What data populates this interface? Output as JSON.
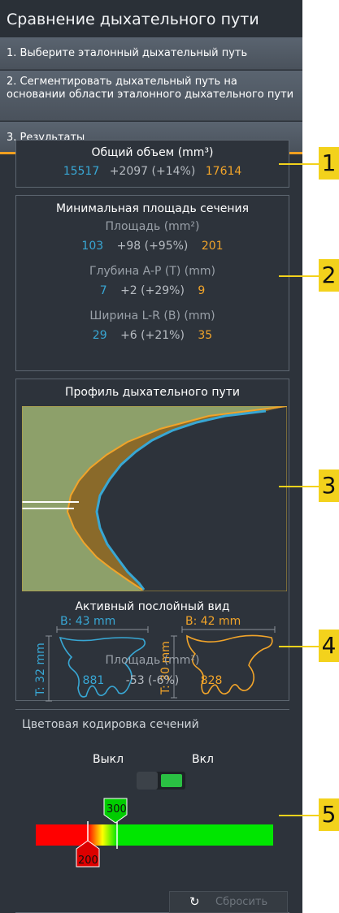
{
  "panel": {
    "title": "Сравнение дыхательного пути",
    "steps": [
      "1. Выберите эталонный дыхательный путь",
      "2. Сегментировать дыхательный путь на основании области эталонного дыхательного пути",
      "3. Результаты"
    ]
  },
  "volume": {
    "header": "Общий объем (mm³)",
    "ref": "15517",
    "diff": "+2097 (+14%)",
    "cur": "17614"
  },
  "min_section": {
    "header": "Минимальная площадь сечения",
    "area_label": "Площадь (mm²)",
    "area_ref": "103",
    "area_diff": "+98 (+95%)",
    "area_cur": "201",
    "depth_label": "Глубина A-P (T) (mm)",
    "depth_ref": "7",
    "depth_diff": "+2 (+29%)",
    "depth_cur": "9",
    "width_label": "Ширина L-R (B) (mm)",
    "width_ref": "29",
    "width_diff": "+6 (+21%)",
    "width_cur": "35"
  },
  "profile": {
    "header": "Профиль дыхательного пути",
    "colors": {
      "ref": "#38a7d4",
      "cur": "#f1a42a",
      "fill_ref": "#8da06a",
      "fill_cur": "#8a6a2a"
    }
  },
  "slice_view": {
    "header": "Активный послойный вид",
    "ref_b": "B: 43 mm",
    "ref_t": "T: 32 mm",
    "cur_b": "B: 42 mm",
    "cur_t": "T: 30 mm",
    "area_label": "Площадь (mm²)",
    "area_ref": "881",
    "area_diff": "-53 (-6%)",
    "area_cur": "828"
  },
  "color_coding": {
    "header": "Цветовая кодировка сечений",
    "off_label": "Выкл",
    "on_label": "Вкл",
    "toggle_on": true,
    "upper_marker": "300",
    "lower_marker": "200",
    "reset_label": "Сбросить",
    "colors": {
      "red": "#ff0000",
      "green": "#00e600",
      "yellow": "#ffff00"
    }
  },
  "callouts": [
    "1",
    "2",
    "3",
    "4",
    "5"
  ]
}
